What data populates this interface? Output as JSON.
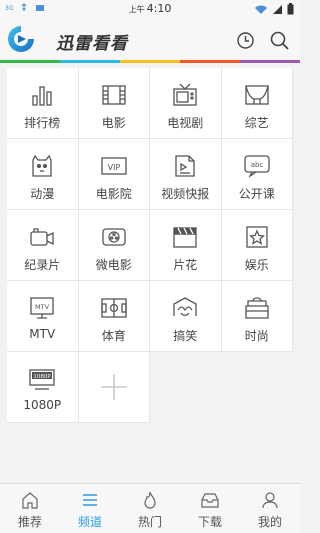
{
  "status_bar": {
    "signal": "3G",
    "ampm": "上午",
    "time": "4:10"
  },
  "header": {
    "brand": "迅雷看看"
  },
  "channels": [
    {
      "label": "排行榜",
      "icon": "ranking-icon"
    },
    {
      "label": "电影",
      "icon": "film-icon"
    },
    {
      "label": "电视剧",
      "icon": "tv-icon"
    },
    {
      "label": "综艺",
      "icon": "stage-icon"
    },
    {
      "label": "动漫",
      "icon": "cartoon-icon"
    },
    {
      "label": "电影院",
      "icon": "vip-icon"
    },
    {
      "label": "视频快报",
      "icon": "news-icon"
    },
    {
      "label": "公开课",
      "icon": "abc-icon"
    },
    {
      "label": "纪录片",
      "icon": "camera-icon"
    },
    {
      "label": "微电影",
      "icon": "film-reel-icon"
    },
    {
      "label": "片花",
      "icon": "clapper-icon"
    },
    {
      "label": "娱乐",
      "icon": "star-icon"
    },
    {
      "label": "MTV",
      "icon": "mtv-icon"
    },
    {
      "label": "体育",
      "icon": "field-icon"
    },
    {
      "label": "搞笑",
      "icon": "smile-icon"
    },
    {
      "label": "时尚",
      "icon": "bag-icon"
    },
    {
      "label": "1080P",
      "icon": "1080p-icon"
    }
  ],
  "icon_mtv_text": "MTV",
  "icon_vip_text": "VIP",
  "icon_abc_text": "abc",
  "icon_1080_text": "1080P",
  "bottom_nav": [
    {
      "label": "推荐",
      "icon": "home-icon"
    },
    {
      "label": "频道",
      "icon": "menu-icon",
      "active": true
    },
    {
      "label": "热门",
      "icon": "flame-icon"
    },
    {
      "label": "下载",
      "icon": "tray-icon"
    },
    {
      "label": "我的",
      "icon": "user-icon"
    }
  ],
  "colors": {
    "accent": "#2a9fe0",
    "icon_stroke": "#555555"
  }
}
